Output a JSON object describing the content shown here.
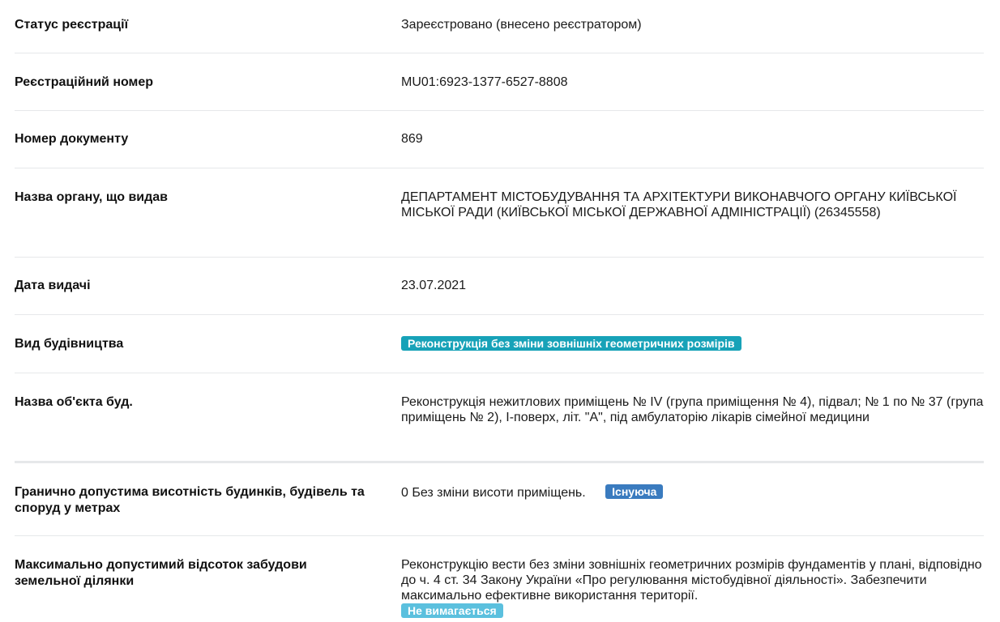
{
  "rows": [
    {
      "label": "Статус реєстрації",
      "value": "Зареєстровано (внесено реєстратором)"
    },
    {
      "label": "Реєстраційний номер",
      "value": "MU01:6923-1377-6527-8808"
    },
    {
      "label": "Номер документу",
      "value": "869"
    },
    {
      "label": "Назва органу, що видав",
      "value": "ДЕПАРТАМЕНТ МІСТОБУДУВАННЯ ТА АРХІТЕКТУРИ ВИКОНАВЧОГО ОРГАНУ КИЇВСЬКОЇ МІСЬКОЇ РАДИ (КИЇВСЬКОЇ МІСЬКОЇ ДЕРЖАВНОЇ АДМІНІСТРАЦІЇ) (26345558)"
    },
    {
      "label": "Дата видачі",
      "value": "23.07.2021"
    },
    {
      "label": "Вид будівництва",
      "badge": "Реконструкція без зміни зовнішніх геометричних розмірів"
    },
    {
      "label": "Назва об'єкта буд.",
      "value": "Реконструкція нежитлових приміщень № IV (група приміщення № 4), підвал; № 1 по № 37 (група приміщень № 2), І-поверх, літ. \"А\", під амбулаторію лікарів сімейної медицини"
    },
    {
      "label": "Гранично допустима висотність будинків, будівель та споруд у метрах",
      "value": "0 Без зміни висоти приміщень.",
      "badge": "Існуюча"
    },
    {
      "label": "Максимально допустимий відсоток забудови земельної ділянки",
      "value": "Реконструкцію вести без зміни зовнішніх геометричних розмірів фундаментів у плані, відповідно до ч. 4 ст. 34 Закону України «Про регулювання містобудівної діяльності». Забезпечити максимально ефективне використання території.",
      "badge": "Не вимагається"
    }
  ],
  "colors": {
    "badge_teal": "#17a2b8",
    "badge_blue": "#3a7bbf",
    "badge_light": "#5bc0de",
    "divider": "#e6e8ea"
  }
}
